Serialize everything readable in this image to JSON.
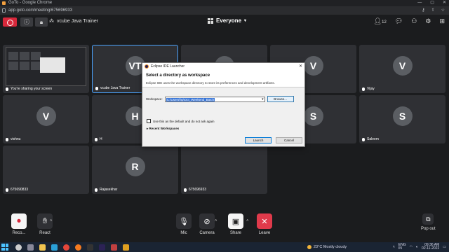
{
  "browser": {
    "window_title": "GoTo - Google Chrome",
    "url": "app.goto.com/meeting/675696933"
  },
  "meeting": {
    "org_label": "vcube Java Trainer",
    "view_label": "Everyone",
    "participant_count": "12"
  },
  "tiles": [
    {
      "initial": "",
      "name": "You're sharing your screen"
    },
    {
      "initial": "VT",
      "name": "vcube Java Trainer"
    },
    {
      "initial": "V",
      "name": ""
    },
    {
      "initial": "V",
      "name": ""
    },
    {
      "initial": "V",
      "name": "Vijay"
    },
    {
      "initial": "V",
      "name": "vishnu"
    },
    {
      "initial": "H",
      "name": "H"
    },
    {
      "initial": "S",
      "name": ""
    },
    {
      "initial": "S",
      "name": ""
    },
    {
      "initial": "S",
      "name": "Saleem"
    },
    {
      "initial": "",
      "name": "675690833"
    },
    {
      "initial": "R",
      "name": "Rajasekhar"
    },
    {
      "initial": "",
      "name": "675696933"
    }
  ],
  "dialog": {
    "title": "Eclipse IDE Launcher",
    "heading": "Select a directory as workspace",
    "description": "Eclipse IDE uses the workspace directory to store its preferences and development artifacts.",
    "workspace_label": "Workspace:",
    "workspace_value": "C:\\Users\\hp\\Oct_Weekend_Batch",
    "browse_label": "Browse...",
    "default_checkbox_label": "Use this as the default and do not ask again",
    "recent_label": "Recent Workspaces",
    "launch_label": "Launch",
    "cancel_label": "Cancel"
  },
  "toolbar": {
    "record_label": "Reco...",
    "react_label": "React",
    "mic_label": "Mic",
    "camera_label": "Camera",
    "share_label": "Share",
    "leave_label": "Leave",
    "popout_label": "Pop out"
  },
  "taskbar": {
    "weather": "23°C  Mostly cloudy",
    "lang": "ENG",
    "region": "IN",
    "time": "09:36 AM",
    "date": "02-11-2022"
  },
  "colors": {
    "record_red": "#d8283b",
    "leave_red": "#e03a4b",
    "tile_bg": "#2f3034",
    "accent_blue": "#3875d7"
  }
}
